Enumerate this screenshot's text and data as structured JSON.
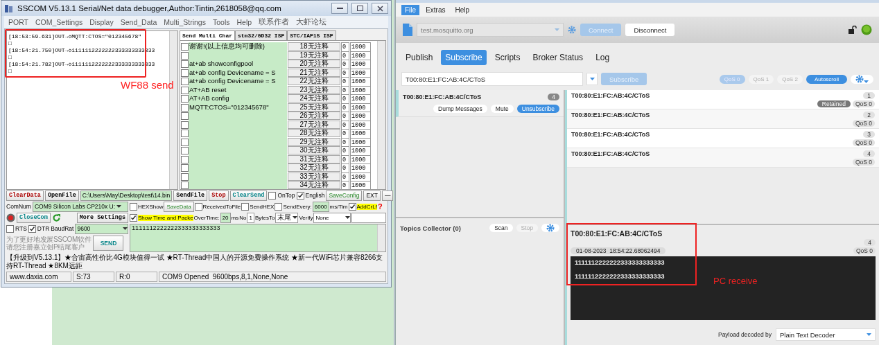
{
  "sscom": {
    "title": "SSCOM V5.13.1 Serial/Net data debugger,Author:Tintin,2618058@qq.com",
    "menu": [
      "PORT",
      "COM_Settings",
      "Display",
      "Send_Data",
      "Multi_Strings",
      "Tools",
      "Help",
      "联系作者",
      "大虾论坛"
    ],
    "receive_lines": [
      "[18:53:59.631]OUT→◇MQTT:CTOS=\"012345678\"",
      "□",
      "[18:54:21.750]OUT→◇1111112222222333333333333",
      "□",
      "[18:54:21.782]OUT→◇1111112222222333333333333",
      "□"
    ],
    "annotation": "WF88 send",
    "tabs": [
      {
        "label": "Send Multi Char",
        "selected": true
      },
      {
        "label": "stm32/GD32 ISP",
        "selected": false
      },
      {
        "label": "STC/IAP15 ISP",
        "selected": false
      }
    ],
    "multi_rows": [
      {
        "checked": false,
        "text": "谢谢!(以上信息均可删除)",
        "button": "18无注释",
        "column_4": "0",
        "column_5": "1000"
      },
      {
        "checked": false,
        "button": "19无注释",
        "column_4": "0",
        "column_5": "1000"
      },
      {
        "checked": false,
        "text": "at+ab showconfigpool",
        "button": "20无注释",
        "column_4": "0",
        "column_5": "1000"
      },
      {
        "checked": false,
        "text": "at+ab config Devicename = S",
        "button": "21无注释",
        "column_4": "0",
        "column_5": "1000"
      },
      {
        "checked": false,
        "text": "at+ab config Devicename = S",
        "button": "22无注释",
        "column_4": "0",
        "column_5": "1000"
      },
      {
        "checked": false,
        "text": "AT+AB reset",
        "button": "23无注释",
        "column_4": "0",
        "column_5": "1000"
      },
      {
        "checked": false,
        "text": "AT+AB config",
        "button": "24无注释",
        "column_4": "0",
        "column_5": "1000"
      },
      {
        "checked": false,
        "text": "MQTT:CTOS=\"012345678\"",
        "button": "25无注释",
        "column_4": "0",
        "column_5": "1000"
      },
      {
        "checked": false,
        "button": "26无注释",
        "column_4": "0",
        "column_5": "1000"
      },
      {
        "checked": false,
        "button": "27无注释",
        "column_4": "0",
        "column_5": "1000"
      },
      {
        "checked": false,
        "button": "28无注释",
        "column_4": "0",
        "column_5": "1000"
      },
      {
        "checked": false,
        "button": "29无注释",
        "column_4": "0",
        "column_5": "1000"
      },
      {
        "checked": false,
        "button": "30无注释",
        "column_4": "0",
        "column_5": "1000"
      },
      {
        "checked": false,
        "button": "31无注释",
        "column_4": "0",
        "column_5": "1000"
      },
      {
        "checked": false,
        "button": "32无注释",
        "column_4": "0",
        "column_5": "1000"
      },
      {
        "checked": false,
        "button": "33无注释",
        "column_4": "0",
        "column_5": "1000"
      },
      {
        "checked": false,
        "button": "34无注释",
        "column_4": "0",
        "column_5": "1000"
      }
    ],
    "clear_data": "ClearData",
    "open_file": "OpenFile",
    "file_path": "C:\\Users\\May\\Desktop\\test\\14.bin",
    "send_file": "SendFile",
    "stop": "Stop",
    "clear_send": "ClearSend",
    "on_top": {
      "label": "OnTop",
      "checked": false
    },
    "english": {
      "label": "English",
      "checked": true
    },
    "save_config": "SaveConfig",
    "ext": "EXT",
    "collapse": "—",
    "com_num_label": "ComNum",
    "com_port": "COM9 Silicon Labs CP210x U:",
    "hex_show": {
      "label": "HEXShow",
      "checked": false
    },
    "save_data": "SaveData",
    "received_to_file": {
      "label": "ReceivedToFile",
      "checked": false
    },
    "send_hex": {
      "label": "SendHEX",
      "checked": false
    },
    "send_every": {
      "label": "SendEvery:",
      "checked": false
    },
    "interval": "6000",
    "interval_unit": "ms/Tim",
    "add_crlf": {
      "label": "AddCrLf",
      "checked": true
    },
    "help_mark": "?",
    "close_com": "CloseCom",
    "more_settings": "More Settings",
    "show_time": {
      "label": "Show Time and Packe",
      "checked": true
    },
    "overtime_label": "OverTime:",
    "overtime": "20",
    "overtime_unit": "ms",
    "no_label": "No",
    "bytes_no": "1",
    "bytes_to_label": "BytesTo",
    "bytes_to": "末尾",
    "verify_label": "Verify",
    "verify": "None",
    "rts": {
      "label": "RTS",
      "checked": false
    },
    "dtr": {
      "label": "DTR",
      "checked": true
    },
    "baud_label": "BaudRat",
    "baud": "9600",
    "send_text": "1111112222222333333333333",
    "promo": [
      "为了更好地发展SSCOM软件",
      "请您注册嘉立创P结尾客户"
    ],
    "send": "SEND",
    "ticker": "【升级到V5.13.1】★合宙高性价比4G模块值得一试 ★RT-Thread中国人的开源免费操作系统 ★新一代WiFi芯片兼容8266支持RT-Thread ★8KM远距",
    "status": [
      "www.daxia.com",
      "S:73",
      "R:0",
      "COM9 Opened  9600bps,8,1,None,None"
    ]
  },
  "mqtt": {
    "menu": [
      {
        "label": "File",
        "selected": true
      },
      {
        "label": "Extras",
        "selected": false
      },
      {
        "label": "Help",
        "selected": false
      }
    ],
    "broker": {
      "value": "test.mosquitto.org",
      "disabled": true
    },
    "connect": {
      "label": "Connect",
      "disabled": true
    },
    "disconnect": {
      "label": "Disconnect",
      "disabled": false
    },
    "tabs": [
      {
        "label": "Publish",
        "selected": false
      },
      {
        "label": "Subscribe",
        "selected": true
      },
      {
        "label": "Scripts",
        "selected": false
      },
      {
        "label": "Broker Status",
        "selected": false
      },
      {
        "label": "Log",
        "selected": false
      }
    ],
    "topic": "T00:80:E1:FC:AB:4C/CToS",
    "subscribe": {
      "label": "Subscribe",
      "disabled": true
    },
    "qos": [
      {
        "label": "QoS 0",
        "selected": true
      },
      {
        "label": "QoS 1",
        "selected": false
      },
      {
        "label": "QoS 2",
        "selected": false
      }
    ],
    "autoscroll": {
      "label": "Autoscroll",
      "on": true
    },
    "subscriptions": [
      {
        "topic": "T00:80:E1:FC:AB:4C/CToS",
        "count": "4"
      }
    ],
    "subscription_buttons": [
      {
        "label": "Dump Messages",
        "kind": "plain"
      },
      {
        "label": "Mute",
        "kind": "plain"
      },
      {
        "label": "Unsubscribe",
        "kind": "primary"
      }
    ],
    "topics_collector": {
      "title": "Topics Collector (0)",
      "scan": {
        "label": "Scan",
        "disabled": false
      },
      "stop": {
        "label": "Stop",
        "disabled": true
      }
    },
    "messages": [
      {
        "topic": "T00:80:E1:FC:AB:4C/CToS",
        "number": "1",
        "badge": "Retained",
        "qos": "QoS 0"
      },
      {
        "topic": "T00:80:E1:FC:AB:4C/CToS",
        "number": "2",
        "qos": "QoS 0"
      },
      {
        "topic": "T00:80:E1:FC:AB:4C/CToS",
        "number": "3",
        "qos": "QoS 0"
      },
      {
        "topic": "T00:80:E1:FC:AB:4C/CToS",
        "number": "4",
        "qos": "QoS 0"
      }
    ],
    "detail": {
      "topic": "T00:80:E1:FC:AB:4C/CToS",
      "number": "4",
      "time": "01-08-2023  18:54:22.68062494",
      "qos": "QoS 0",
      "payload": [
        "1111112222222333333333333",
        "1111112222222333333333333"
      ]
    },
    "annotation": "PC receive",
    "decoder_label": "Payload decoded by",
    "decoder": "Plain Text Decoder"
  }
}
